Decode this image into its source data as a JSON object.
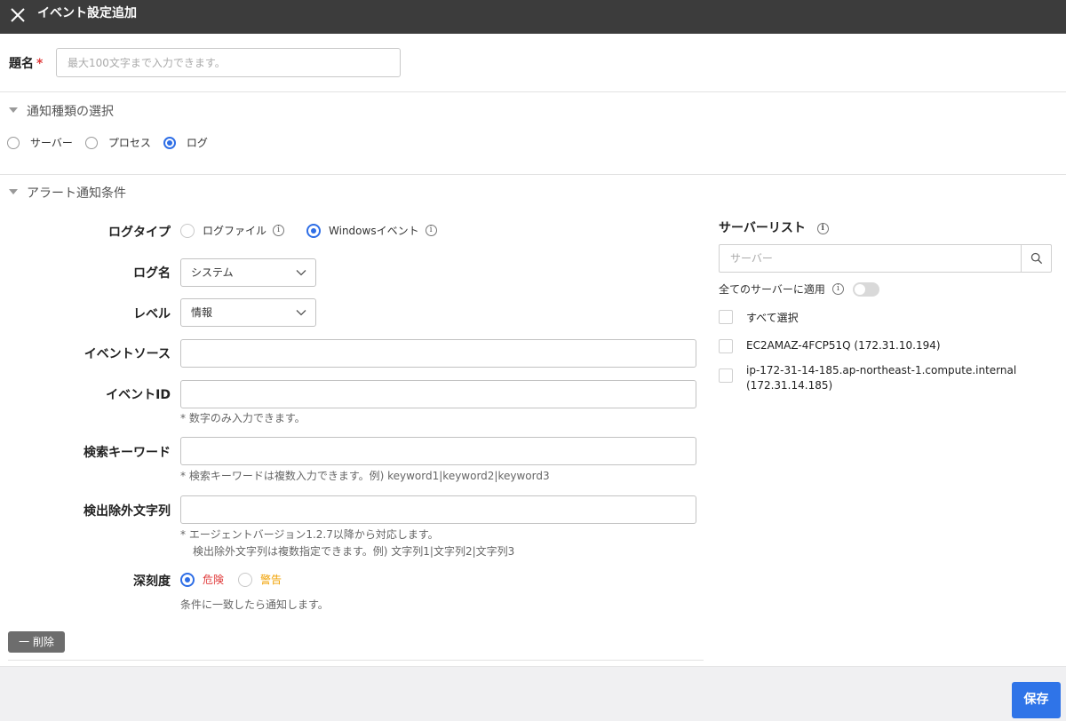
{
  "header": {
    "title": "イベント設定追加"
  },
  "title_field": {
    "label": "題名",
    "required_mark": "*",
    "placeholder": "最大100文字まで入力できます。",
    "value": ""
  },
  "notif_section": {
    "heading": "通知種類の選択",
    "options": [
      {
        "label": "サーバー",
        "selected": false
      },
      {
        "label": "プロセス",
        "selected": false
      },
      {
        "label": "ログ",
        "selected": true
      }
    ]
  },
  "alert_section": {
    "heading": "アラート通知条件",
    "log_type": {
      "label": "ログタイプ",
      "options": [
        {
          "label": "ログファイル",
          "selected": false
        },
        {
          "label": "Windowsイベント",
          "selected": true
        }
      ]
    },
    "log_name": {
      "label": "ログ名",
      "value": "システム"
    },
    "level": {
      "label": "レベル",
      "value": "情報"
    },
    "event_source": {
      "label": "イベントソース",
      "value": ""
    },
    "event_id": {
      "label": "イベントID",
      "value": "",
      "hint": "* 数字のみ入力できます。"
    },
    "keyword": {
      "label": "検索キーワード",
      "value": "",
      "hint": "* 検索キーワードは複数入力できます。例) keyword1|keyword2|keyword3"
    },
    "exclude": {
      "label": "検出除外文字列",
      "value": "",
      "hint1": "* エージェントバージョン1.2.7以降から対応します。",
      "hint2": "検出除外文字列は複数指定できます。例) 文字列1|文字列2|文字列3"
    },
    "severity": {
      "label": "深刻度",
      "options": [
        {
          "label": "危険",
          "selected": true,
          "color": "#e03b3b"
        },
        {
          "label": "警告",
          "selected": false,
          "color": "#f0a000"
        }
      ],
      "hint": "条件に一致したら通知します。"
    },
    "delete_label": "一 削除"
  },
  "server_list": {
    "title": "サーバーリスト",
    "search_placeholder": "サーバー",
    "apply_all_label": "全てのサーバーに適用",
    "apply_all_on": false,
    "select_all_label": "すべて選択",
    "servers": [
      {
        "line1": "EC2AMAZ-4FCP51Q (172.31.10.194)",
        "line2": ""
      },
      {
        "line1": "ip-172-31-14-185.ap-northeast-1.compute.internal",
        "line2": "(172.31.14.185)"
      }
    ]
  },
  "footer": {
    "save_label": "保存"
  },
  "colors": {
    "accent": "#2f74e8",
    "header_bg": "#3c3c3c",
    "danger": "#e03b3b",
    "warning": "#f0a000"
  }
}
